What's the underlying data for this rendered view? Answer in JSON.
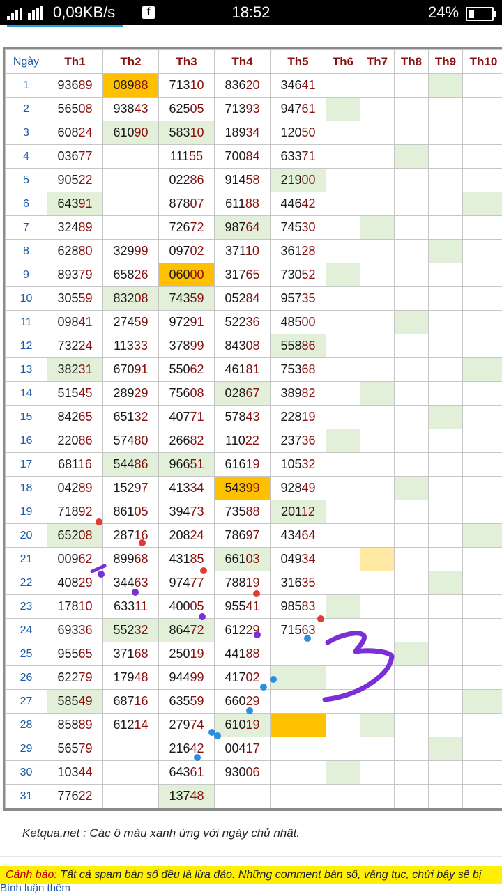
{
  "status": {
    "network_speed": "0,09KB/s",
    "time": "18:52",
    "battery": "24%",
    "app_icon": "facebook-icon"
  },
  "table": {
    "headers": [
      "Ngày",
      "Th1",
      "Th2",
      "Th3",
      "Th4",
      "Th5",
      "Th6",
      "Th7",
      "Th8",
      "Th9",
      "Th10"
    ],
    "rows": [
      {
        "day": "1",
        "cells": [
          "93689",
          "08988",
          "71310",
          "83620",
          "34641",
          "",
          "",
          "",
          "",
          ""
        ],
        "fill": [
          "",
          "o",
          "",
          "",
          "",
          "",
          "",
          "",
          "g",
          ""
        ]
      },
      {
        "day": "2",
        "cells": [
          "56508",
          "93843",
          "62505",
          "71393",
          "94761",
          "",
          "",
          "",
          "",
          ""
        ],
        "fill": [
          "",
          "",
          "",
          "",
          "",
          "g",
          "",
          "",
          "",
          ""
        ]
      },
      {
        "day": "3",
        "cells": [
          "60824",
          "61090",
          "58310",
          "18934",
          "12050",
          "",
          "",
          "",
          "",
          ""
        ],
        "fill": [
          "",
          "g",
          "g",
          "",
          "",
          "",
          "",
          "",
          "",
          ""
        ]
      },
      {
        "day": "4",
        "cells": [
          "03677",
          "",
          "11155",
          "70084",
          "63371",
          "",
          "",
          "",
          "",
          ""
        ],
        "fill": [
          "",
          "",
          "",
          "",
          "",
          "",
          "",
          "g",
          "",
          ""
        ]
      },
      {
        "day": "5",
        "cells": [
          "90522",
          "",
          "02286",
          "91458",
          "21900",
          "",
          "",
          "",
          "",
          ""
        ],
        "fill": [
          "",
          "",
          "",
          "",
          "g",
          "",
          "",
          "",
          "",
          ""
        ]
      },
      {
        "day": "6",
        "cells": [
          "64391",
          "",
          "87807",
          "61188",
          "44642",
          "",
          "",
          "",
          "",
          ""
        ],
        "fill": [
          "g",
          "",
          "",
          "",
          "",
          "",
          "",
          "",
          "",
          "g"
        ]
      },
      {
        "day": "7",
        "cells": [
          "32489",
          "",
          "72672",
          "98764",
          "74530",
          "",
          "",
          "",
          "",
          ""
        ],
        "fill": [
          "",
          "",
          "",
          "g",
          "",
          "",
          "g",
          "",
          "",
          ""
        ]
      },
      {
        "day": "8",
        "cells": [
          "62880",
          "32999",
          "09702",
          "37110",
          "36128",
          "",
          "",
          "",
          "",
          ""
        ],
        "fill": [
          "",
          "",
          "",
          "",
          "",
          "",
          "",
          "",
          "g",
          ""
        ]
      },
      {
        "day": "9",
        "cells": [
          "89379",
          "65826",
          "06000",
          "31765",
          "73052",
          "",
          "",
          "",
          "",
          ""
        ],
        "fill": [
          "",
          "",
          "o",
          "",
          "",
          "g",
          "",
          "",
          "",
          ""
        ]
      },
      {
        "day": "10",
        "cells": [
          "30559",
          "83208",
          "74359",
          "05284",
          "95735",
          "",
          "",
          "",
          "",
          ""
        ],
        "fill": [
          "",
          "g",
          "g",
          "",
          "",
          "",
          "",
          "",
          "",
          ""
        ]
      },
      {
        "day": "11",
        "cells": [
          "09841",
          "27459",
          "97291",
          "52236",
          "48500",
          "",
          "",
          "",
          "",
          ""
        ],
        "fill": [
          "",
          "",
          "",
          "",
          "",
          "",
          "",
          "g",
          "",
          ""
        ]
      },
      {
        "day": "12",
        "cells": [
          "73224",
          "11333",
          "37899",
          "84308",
          "55886",
          "",
          "",
          "",
          "",
          ""
        ],
        "fill": [
          "",
          "",
          "",
          "",
          "g",
          "",
          "",
          "",
          "",
          ""
        ]
      },
      {
        "day": "13",
        "cells": [
          "38231",
          "67091",
          "55062",
          "46181",
          "75368",
          "",
          "",
          "",
          "",
          ""
        ],
        "fill": [
          "g",
          "",
          "",
          "",
          "",
          "",
          "",
          "",
          "",
          "g"
        ]
      },
      {
        "day": "14",
        "cells": [
          "51545",
          "28929",
          "75608",
          "02867",
          "38982",
          "",
          "",
          "",
          "",
          ""
        ],
        "fill": [
          "",
          "",
          "",
          "g",
          "",
          "",
          "g",
          "",
          "",
          ""
        ]
      },
      {
        "day": "15",
        "cells": [
          "84265",
          "65132",
          "40771",
          "57843",
          "22819",
          "",
          "",
          "",
          "",
          ""
        ],
        "fill": [
          "",
          "",
          "",
          "",
          "",
          "",
          "",
          "",
          "g",
          ""
        ]
      },
      {
        "day": "16",
        "cells": [
          "22086",
          "57480",
          "26682",
          "11022",
          "23736",
          "",
          "",
          "",
          "",
          ""
        ],
        "fill": [
          "",
          "",
          "",
          "",
          "",
          "g",
          "",
          "",
          "",
          ""
        ]
      },
      {
        "day": "17",
        "cells": [
          "68116",
          "54486",
          "96651",
          "61619",
          "10532",
          "",
          "",
          "",
          "",
          ""
        ],
        "fill": [
          "",
          "g",
          "g",
          "",
          "",
          "",
          "",
          "",
          "",
          ""
        ]
      },
      {
        "day": "18",
        "cells": [
          "04289",
          "15297",
          "41334",
          "54399",
          "92849",
          "",
          "",
          "",
          "",
          ""
        ],
        "fill": [
          "",
          "",
          "",
          "o",
          "",
          "",
          "",
          "g",
          "",
          ""
        ]
      },
      {
        "day": "19",
        "cells": [
          "71892",
          "86105",
          "39473",
          "73588",
          "20112",
          "",
          "",
          "",
          "",
          ""
        ],
        "fill": [
          "",
          "",
          "",
          "",
          "g",
          "",
          "",
          "",
          "",
          ""
        ]
      },
      {
        "day": "20",
        "cells": [
          "65208",
          "28716",
          "20824",
          "78697",
          "43464",
          "",
          "",
          "",
          "",
          ""
        ],
        "fill": [
          "g",
          "",
          "",
          "",
          "",
          "",
          "",
          "",
          "",
          "g"
        ]
      },
      {
        "day": "21",
        "cells": [
          "00962",
          "89968",
          "43185",
          "66103",
          "04934",
          "",
          "",
          "",
          "",
          ""
        ],
        "fill": [
          "",
          "",
          "",
          "g",
          "",
          "",
          "y",
          "",
          "",
          ""
        ]
      },
      {
        "day": "22",
        "cells": [
          "40829",
          "34463",
          "97477",
          "78819",
          "31635",
          "",
          "",
          "",
          "",
          ""
        ],
        "fill": [
          "",
          "",
          "",
          "",
          "",
          "",
          "",
          "",
          "g",
          ""
        ]
      },
      {
        "day": "23",
        "cells": [
          "17810",
          "63311",
          "40005",
          "95541",
          "98583",
          "",
          "",
          "",
          "",
          ""
        ],
        "fill": [
          "",
          "",
          "",
          "",
          "",
          "g",
          "",
          "",
          "",
          ""
        ]
      },
      {
        "day": "24",
        "cells": [
          "69336",
          "55232",
          "86472",
          "61229",
          "71563",
          "",
          "",
          "",
          "",
          ""
        ],
        "fill": [
          "",
          "g",
          "g",
          "",
          "",
          "",
          "",
          "",
          "",
          ""
        ]
      },
      {
        "day": "25",
        "cells": [
          "95565",
          "37168",
          "25019",
          "44188",
          "",
          "",
          "",
          "",
          "",
          ""
        ],
        "fill": [
          "",
          "",
          "",
          "",
          "",
          "",
          "",
          "g",
          "",
          ""
        ]
      },
      {
        "day": "26",
        "cells": [
          "62279",
          "17948",
          "94499",
          "41702",
          "",
          "",
          "",
          "",
          "",
          ""
        ],
        "fill": [
          "",
          "",
          "",
          "",
          "g",
          "",
          "",
          "",
          "",
          ""
        ]
      },
      {
        "day": "27",
        "cells": [
          "58549",
          "68716",
          "63559",
          "66029",
          "",
          "",
          "",
          "",
          "",
          ""
        ],
        "fill": [
          "g",
          "",
          "",
          "",
          "",
          "",
          "",
          "",
          "",
          "g"
        ]
      },
      {
        "day": "28",
        "cells": [
          "85889",
          "61214",
          "27974",
          "61019",
          "",
          "",
          "",
          "",
          "",
          ""
        ],
        "fill": [
          "",
          "",
          "",
          "g",
          "o",
          "",
          "g",
          "",
          "",
          ""
        ]
      },
      {
        "day": "29",
        "cells": [
          "56579",
          "",
          "21642",
          "00417",
          "",
          "",
          "",
          "",
          "",
          ""
        ],
        "fill": [
          "",
          "",
          "",
          "",
          "",
          "",
          "",
          "",
          "g",
          ""
        ]
      },
      {
        "day": "30",
        "cells": [
          "10344",
          "",
          "64361",
          "93006",
          "",
          "",
          "",
          "",
          "",
          ""
        ],
        "fill": [
          "",
          "",
          "",
          "",
          "",
          "g",
          "",
          "",
          "",
          ""
        ]
      },
      {
        "day": "31",
        "cells": [
          "77622",
          "",
          "13748",
          "",
          "",
          "",
          "",
          "",
          "",
          ""
        ],
        "fill": [
          "",
          "",
          "g",
          "",
          "",
          "",
          "",
          "",
          "",
          ""
        ]
      }
    ]
  },
  "footer": {
    "note": "Ketqua.net : Các ô màu xanh ứng với ngày chủ nhật.",
    "warning_label": "Cảnh báo:",
    "warning_text": "Tất cả spam bán số đều là lừa đảo. Những comment bán số, văng tục, chửi bậy sẽ bị",
    "more_link": "Bình luận thêm"
  },
  "colors": {
    "sunday": "#e2f0d9",
    "highlight": "#ffc000",
    "highlight_light": "#ffe9a3",
    "header": "#8b1010",
    "day": "#1a5aa8"
  }
}
